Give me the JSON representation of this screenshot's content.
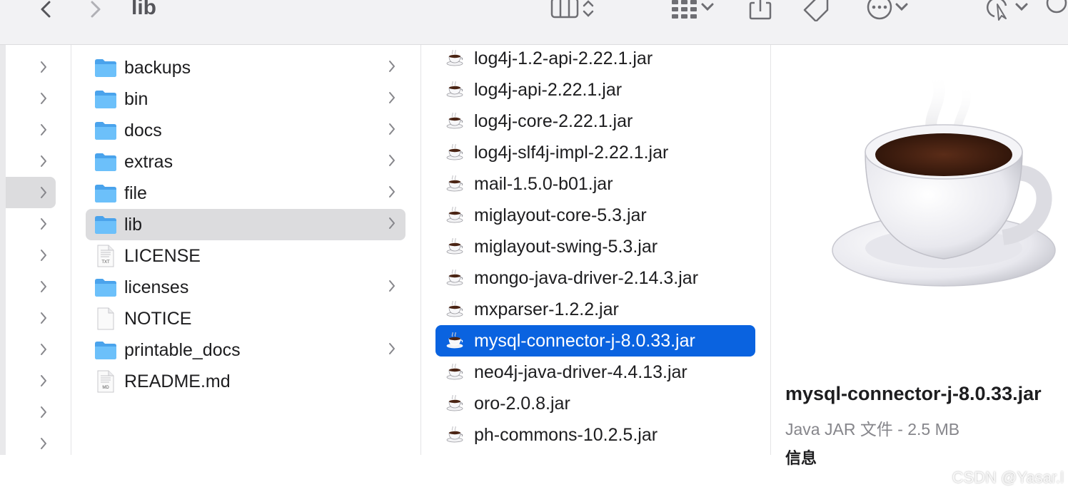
{
  "window": {
    "title": "lib"
  },
  "sidebar_rows": [
    {
      "selected": false
    },
    {
      "selected": false
    },
    {
      "selected": false
    },
    {
      "selected": false
    },
    {
      "selected": true
    },
    {
      "selected": false
    },
    {
      "selected": false
    },
    {
      "selected": false
    },
    {
      "selected": false
    },
    {
      "selected": false
    },
    {
      "selected": false
    },
    {
      "selected": false
    },
    {
      "selected": false
    }
  ],
  "folder_column": {
    "items": [
      {
        "label": "backups",
        "kind": "folder",
        "has_children": true
      },
      {
        "label": "bin",
        "kind": "folder",
        "has_children": true
      },
      {
        "label": "docs",
        "kind": "folder",
        "has_children": true
      },
      {
        "label": "extras",
        "kind": "folder",
        "has_children": true
      },
      {
        "label": "file",
        "kind": "folder",
        "has_children": true
      },
      {
        "label": "lib",
        "kind": "folder",
        "has_children": true,
        "selected": true
      },
      {
        "label": "LICENSE",
        "kind": "txt",
        "has_children": false
      },
      {
        "label": "licenses",
        "kind": "folder",
        "has_children": true
      },
      {
        "label": "NOTICE",
        "kind": "blank",
        "has_children": false
      },
      {
        "label": "printable_docs",
        "kind": "folder",
        "has_children": true
      },
      {
        "label": "README.md",
        "kind": "md",
        "has_children": false
      }
    ]
  },
  "file_column": {
    "items": [
      {
        "label": "log4j-1.2-api-2.22.1.jar"
      },
      {
        "label": "log4j-api-2.22.1.jar"
      },
      {
        "label": "log4j-core-2.22.1.jar"
      },
      {
        "label": "log4j-slf4j-impl-2.22.1.jar"
      },
      {
        "label": "mail-1.5.0-b01.jar"
      },
      {
        "label": "miglayout-core-5.3.jar"
      },
      {
        "label": "miglayout-swing-5.3.jar"
      },
      {
        "label": "mongo-java-driver-2.14.3.jar"
      },
      {
        "label": "mxparser-1.2.2.jar"
      },
      {
        "label": "mysql-connector-j-8.0.33.jar",
        "selected": true
      },
      {
        "label": "neo4j-java-driver-4.4.13.jar"
      },
      {
        "label": "oro-2.0.8.jar"
      },
      {
        "label": "ph-commons-10.2.5.jar"
      }
    ]
  },
  "preview": {
    "name": "mysql-connector-j-8.0.33.jar",
    "kind_size": "Java JAR 文件 - 2.5 MB",
    "section": "信息"
  },
  "watermark": "CSDN @Yasar.l",
  "colors": {
    "selection_accent": "#0a63e0",
    "folder_blue": "#56b4f5"
  },
  "icons": [
    "chevron-left-icon",
    "chevron-right-icon",
    "column-view-icon",
    "grid-view-icon",
    "share-icon",
    "tag-icon",
    "more-icon",
    "markup-icon",
    "folder-icon",
    "text-file-icon",
    "java-cup-icon"
  ]
}
